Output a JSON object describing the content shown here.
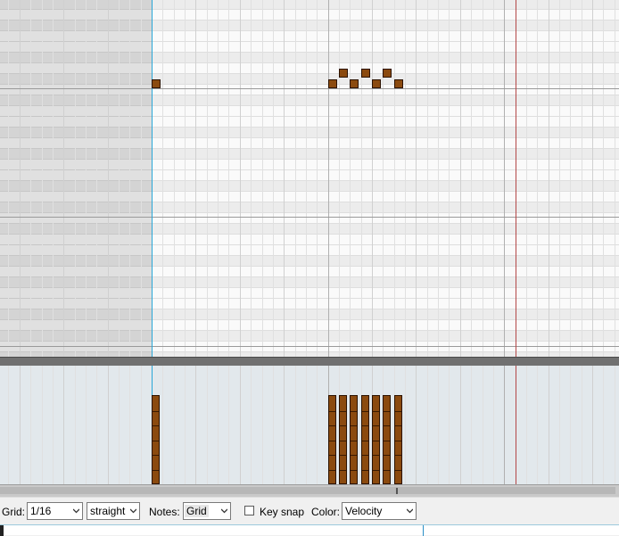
{
  "editor": {
    "notes": [
      {
        "step": 0,
        "row": 0
      },
      {
        "step": 16,
        "row": 0
      },
      {
        "step": 17,
        "row": 1
      },
      {
        "step": 18,
        "row": 0
      },
      {
        "step": 19,
        "row": 1
      },
      {
        "step": 20,
        "row": 0
      },
      {
        "step": 21,
        "row": 1
      },
      {
        "step": 22,
        "row": 0
      }
    ],
    "velocities": [
      1,
      1,
      1,
      1,
      1,
      1,
      1,
      1
    ],
    "colors": {
      "note_fill": "#8b4a0f",
      "note_border": "#2b1200",
      "playhead": "#2aa7d8",
      "end_marker": "#b34848",
      "velocity_bg": "#e2e8ec"
    }
  },
  "toolbar": {
    "grid_label": "Grid:",
    "grid_value": "1/16",
    "grid_type": "straight",
    "notes_label": "Notes:",
    "notes_value": "Grid",
    "key_snap_label": "Key snap",
    "key_snap_checked": false,
    "color_label": "Color:",
    "color_value": "Velocity"
  },
  "icons": {
    "dropdown": "chevron-down-icon"
  }
}
